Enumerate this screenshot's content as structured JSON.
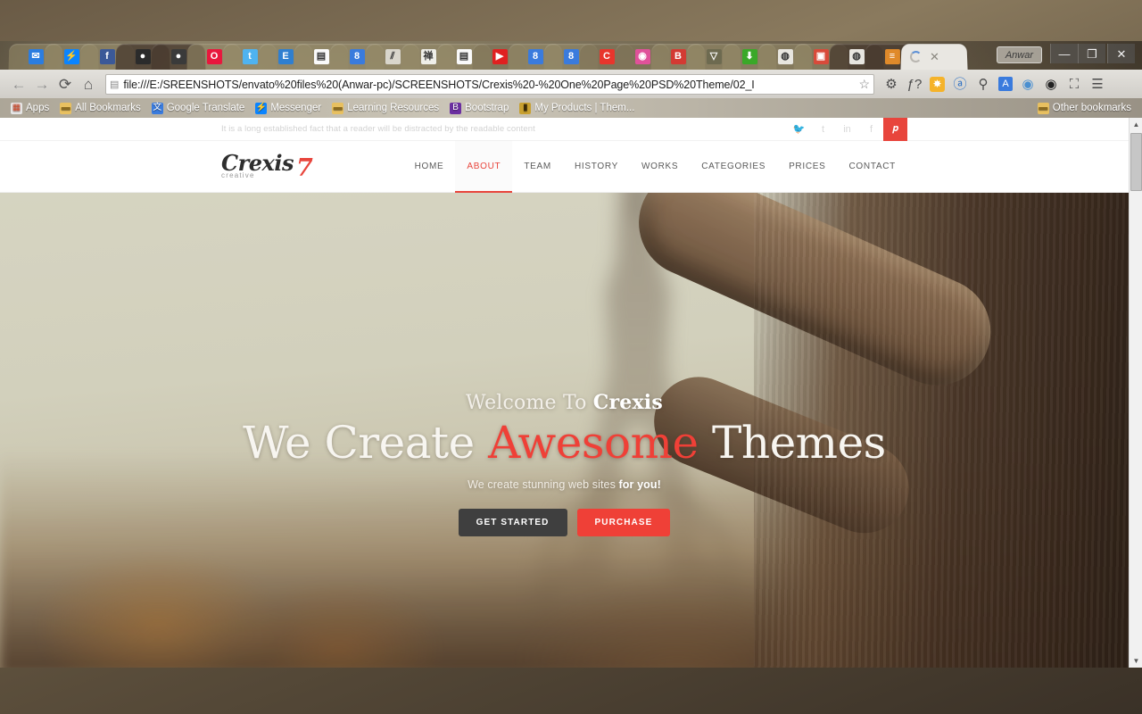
{
  "window": {
    "user_button": "Anwar",
    "minimize": "—",
    "maximize": "❐",
    "close": "✕"
  },
  "tabs": [
    {
      "name": "inbox-tab",
      "icon": "inbox-icon",
      "glyph": "✉",
      "bg": "#2b7de0",
      "active": false
    },
    {
      "name": "messenger-tab",
      "icon": "messenger-icon",
      "glyph": "⚡",
      "bg": "#0a84ff",
      "active": false
    },
    {
      "name": "facebook-tab",
      "icon": "facebook-icon",
      "glyph": "f",
      "bg": "#3b5998",
      "active": false
    },
    {
      "name": "github-tab-1",
      "icon": "github-icon",
      "glyph": "●",
      "bg": "#2b2b2b",
      "active": false
    },
    {
      "name": "github-tab-2",
      "icon": "github-icon",
      "glyph": "●",
      "bg": "#3a3a3a",
      "active": false
    },
    {
      "name": "opera-tab",
      "icon": "opera-icon",
      "glyph": "O",
      "bg": "#e8173d",
      "active": false
    },
    {
      "name": "twitter-tab",
      "icon": "twitter-icon",
      "glyph": "t",
      "bg": "#4fb3f0",
      "active": false
    },
    {
      "name": "envato-tab",
      "icon": "envato-icon",
      "glyph": "E",
      "bg": "#2f7fd0",
      "active": false
    },
    {
      "name": "document-tab-1",
      "icon": "page-icon",
      "glyph": "▤",
      "bg": "#fafafa",
      "active": false
    },
    {
      "name": "google-tab-1",
      "icon": "google-8-icon",
      "glyph": "8",
      "bg": "#3a7bdd",
      "active": false
    },
    {
      "name": "slashes-tab",
      "icon": "slashes-icon",
      "glyph": "⫽",
      "bg": "#d9d6cc",
      "active": false
    },
    {
      "name": "zen-tab",
      "icon": "zen-kanji-icon",
      "glyph": "禅",
      "bg": "#efefe9",
      "active": false
    },
    {
      "name": "document-tab-2",
      "icon": "page-icon",
      "glyph": "▤",
      "bg": "#fafafa",
      "active": false
    },
    {
      "name": "youtube-tab",
      "icon": "youtube-icon",
      "glyph": "▶",
      "bg": "#e02020",
      "active": false
    },
    {
      "name": "google-tab-2",
      "icon": "google-8-icon",
      "glyph": "8",
      "bg": "#3a7bdd",
      "active": false
    },
    {
      "name": "google-tab-3",
      "icon": "google-8-icon",
      "glyph": "8",
      "bg": "#3a7bdd",
      "active": false
    },
    {
      "name": "codepen-tab",
      "icon": "c-circle-icon",
      "glyph": "C",
      "bg": "#e8352c",
      "active": false
    },
    {
      "name": "dribbble-tab",
      "icon": "dribbble-icon",
      "glyph": "◉",
      "bg": "#e0519a",
      "active": false
    },
    {
      "name": "bootstrap-tab",
      "icon": "bootstrap-icon",
      "glyph": "B",
      "bg": "#d33a33",
      "active": false
    },
    {
      "name": "firefox-tab",
      "icon": "fox-icon",
      "glyph": "▽",
      "bg": "#6d6a50",
      "active": false
    },
    {
      "name": "download-tab",
      "icon": "download-icon",
      "glyph": "⬇",
      "bg": "#3aa828",
      "active": false
    },
    {
      "name": "chrome-tab-1",
      "icon": "chrome-icon",
      "glyph": "◍",
      "bg": "#e8e6e0",
      "active": false
    },
    {
      "name": "photo-tab",
      "icon": "camera-icon",
      "glyph": "▣",
      "bg": "#d84a3a",
      "active": false
    },
    {
      "name": "chrome-tab-2",
      "icon": "chrome-icon",
      "glyph": "◍",
      "bg": "#e8e6e0",
      "active": false
    },
    {
      "name": "stackoverflow-tab",
      "icon": "stackoverflow-icon",
      "glyph": "≡",
      "bg": "#e08a2a",
      "active": false
    },
    {
      "name": "loading-tab",
      "icon": "loading-spinner-icon",
      "glyph": "",
      "bg": "#ffffff",
      "active": true
    }
  ],
  "toolbar": {
    "back": "←",
    "forward": "→",
    "reload": "⟳",
    "home": "⌂",
    "url": "file:///E:/SREENSHOTS/envato%20files%20(Anwar-pc)/SCREENSHOTS/Crexis%20-%20One%20Page%20PSD%20Theme/02_I",
    "page_icon": "page-icon",
    "bookmark_star": "☆",
    "extensions": [
      {
        "name": "gear-extension",
        "glyph": "⚙"
      },
      {
        "name": "function-extension",
        "glyph": "ƒ?"
      },
      {
        "name": "asterisk-extension",
        "glyph": "✸"
      },
      {
        "name": "at-extension",
        "glyph": "ⓐ"
      },
      {
        "name": "eyedropper-extension",
        "glyph": "⚲"
      },
      {
        "name": "translate-extension",
        "glyph": "A"
      },
      {
        "name": "globe-extension",
        "glyph": "◉"
      },
      {
        "name": "colorwheel-extension",
        "glyph": "◉"
      },
      {
        "name": "fullscreen-extension",
        "glyph": "⛶"
      },
      {
        "name": "chrome-menu",
        "glyph": "☰"
      }
    ]
  },
  "bookmarks": {
    "items": [
      {
        "label": "Apps",
        "icon": "apps-grid-icon",
        "glyph": "▦",
        "bg": "#e6e6e6",
        "color": "#d04a2a"
      },
      {
        "label": "All Bookmarks",
        "icon": "folder-icon",
        "glyph": "▬",
        "bg": "#e8c060",
        "color": "#8a6a20"
      },
      {
        "label": "Google Translate",
        "icon": "translate-icon",
        "glyph": "文",
        "bg": "#3a7bdd",
        "color": "#ffffff"
      },
      {
        "label": "Messenger",
        "icon": "messenger-icon",
        "glyph": "⚡",
        "bg": "#0a84ff",
        "color": "#ffffff"
      },
      {
        "label": "Learning Resources",
        "icon": "folder-icon",
        "glyph": "▬",
        "bg": "#e8c060",
        "color": "#8a6a20"
      },
      {
        "label": "Bootstrap",
        "icon": "bootstrap-icon",
        "glyph": "B",
        "bg": "#6b2fa0",
        "color": "#ffffff"
      },
      {
        "label": "My Products | Them...",
        "icon": "themeforest-icon",
        "glyph": "▮",
        "bg": "#c8a030",
        "color": "#3a2a08"
      }
    ],
    "other_label": "Other bookmarks",
    "other_icon": "folder-icon"
  },
  "site": {
    "topbar": {
      "tagline": "It is a long established fact that a reader will be distracted by the readable content",
      "socials": [
        {
          "name": "twitter-icon",
          "glyph": "🐦",
          "label": "twitter",
          "active": false
        },
        {
          "name": "tumblr-icon",
          "glyph": "t",
          "label": "tumblr",
          "active": false
        },
        {
          "name": "linkedin-icon",
          "glyph": "in",
          "label": "linkedin",
          "active": false
        },
        {
          "name": "facebook-icon",
          "glyph": "f",
          "label": "facebook",
          "active": false
        },
        {
          "name": "pinterest-icon",
          "glyph": "𝒑",
          "label": "pinterest",
          "active": true
        }
      ]
    },
    "logo": {
      "word": "Crexis",
      "sub": "creative",
      "mark": "7"
    },
    "nav": [
      {
        "label": "HOME",
        "active": false
      },
      {
        "label": "ABOUT",
        "active": true
      },
      {
        "label": "TEAM",
        "active": false
      },
      {
        "label": "HISTORY",
        "active": false
      },
      {
        "label": "WORKS",
        "active": false
      },
      {
        "label": "CATEGORIES",
        "active": false
      },
      {
        "label": "PRICES",
        "active": false
      },
      {
        "label": "CONTACT",
        "active": false
      }
    ],
    "hero": {
      "welcome_prefix": "Welcome To ",
      "welcome_brand": "Crexis",
      "headline_a": "We Create ",
      "headline_highlight": "Awesome",
      "headline_b": " Themes",
      "subline_a": "We create stunning web sites ",
      "subline_b": "for you!",
      "cta_primary": "GET STARTED",
      "cta_secondary": "PURCHASE"
    },
    "colors": {
      "accent": "#ef4037",
      "dark_button": "#3f3f3f",
      "nav_text": "#5a5a5a"
    }
  },
  "scrollbar": {
    "up": "▲",
    "down": "▼"
  }
}
